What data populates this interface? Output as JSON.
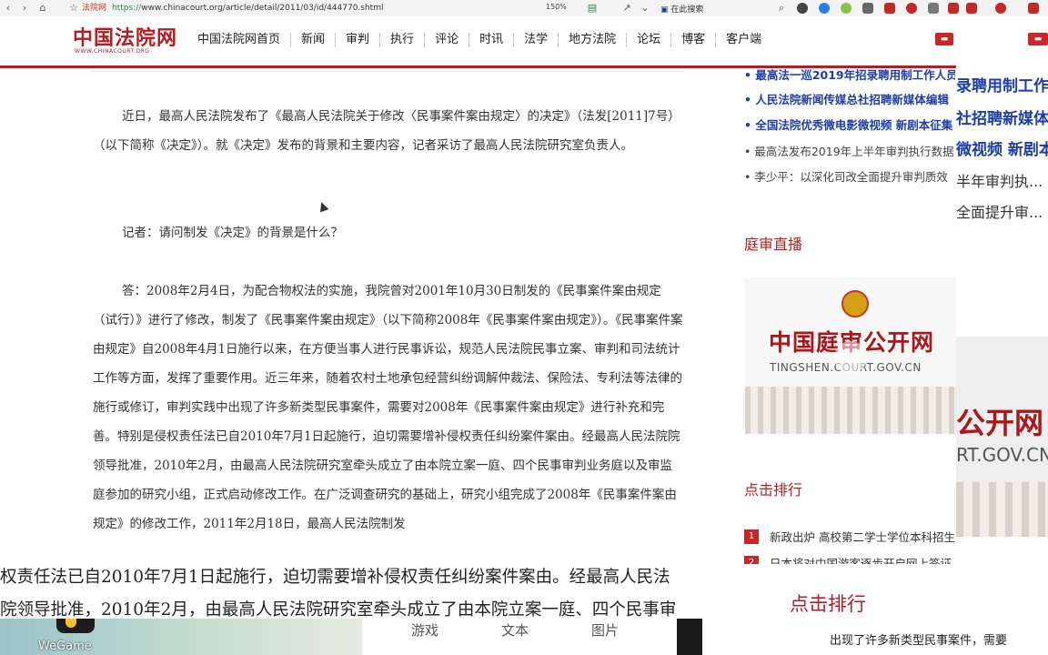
{
  "browser": {
    "site_label": "法院网",
    "url_scheme": "https://",
    "url_rest": "www.chinacourt.org/article/detail/2011/03/id/444770.shtml",
    "zoom": "150%",
    "search_placeholder": "在此搜索"
  },
  "site": {
    "logo_text": "中国法院网",
    "logo_sub": "WWW.CHINACOURT.ORG",
    "nav": [
      "中国法院网首页",
      "新闻",
      "审判",
      "执行",
      "评论",
      "时讯",
      "法学",
      "地方法院",
      "论坛",
      "博客",
      "客户端"
    ]
  },
  "article": {
    "para1": "近日，最高人民法院发布了《最高人民法院关于修改〈民事案件案由规定〉的决定》（法发[2011]7号）（以下简称《决定》）。就《决定》发布的背景和主要内容，记者采访了最高人民法院研究室负责人。",
    "para2": "记者：请问制发《决定》的背景是什么？",
    "para3": "答：2008年2月4日，为配合物权法的实施，我院曾对2001年10月30日制发的《民事案件案由规定（试行）》进行了修改，制发了《民事案件案由规定》（以下简称2008年《民事案件案由规定》）。《民事案件案由规定》自2008年4月1日施行以来，在方便当事人进行民事诉讼，规范人民法院民事立案、审判和司法统计工作等方面，发挥了重要作用。近三年来，随着农村土地承包经营纠纷调解仲裁法、保险法、专利法等法律的施行或修订，审判实践中出现了许多新类型民事案件，需要对2008年《民事案件案由规定》进行补充和完善。特别是侵权责任法已自2010年7月1日起施行，迫切需要增补侵权责任纠纷案件案由。经最高人民法院院领导批准，2010年2月，由最高人民法院研究室牵头成立了由本院立案一庭、四个民事审判业务庭以及审监庭参加的研究小组，正式启动修改工作。在广泛调查研究的基础上，研究小组完成了2008年《民事案件案由规定》的修改工作，2011年2月18日，最高人民法院制发"
  },
  "sidebar": {
    "news": [
      {
        "text": "最高法一巡2019年招录聘用制工作人员",
        "style": "blue"
      },
      {
        "text": "人民法院新闻传媒总社招聘新媒体编辑",
        "style": "blue"
      },
      {
        "text": "全国法院优秀微电影微视频 新剧本征集",
        "style": "blue"
      },
      {
        "text": "最高法发布2019年上半年审判执行数据",
        "style": "grey"
      },
      {
        "text": "李少平：以深化司改全面提升审判质效",
        "style": "grey"
      }
    ],
    "live_title": "庭审直播",
    "banner_title": "中国庭审公开网",
    "banner_domain": "TINGSHEN.COURT.GOV.CN",
    "rank_title": "点击排行",
    "ranking": [
      {
        "num": "1",
        "text": "新政出炉 高校第二学士学位本科招生"
      },
      {
        "num": "2",
        "text": "日本将对中国游客逐步开启网上签证"
      }
    ]
  },
  "overlay": {
    "right_ghost": [
      "录聘用制工作",
      "社招聘新媒体",
      "微视频 新剧本",
      "半年审判执...",
      "全面提升审..."
    ],
    "banner_ghost_title": "公开网",
    "banner_ghost_domain": "RT.GOV.CN",
    "line1": "权责任法已自2010年7月1日起施行，迫切需要增补侵权责任纠纷案件案由。经最高人民法",
    "line2": "院领导批准，2010年2月，由最高人民法院研究室牵头成立了由本院立案一庭、四个民事审",
    "rank_big": "点击排行",
    "bottom_right": "出现了许多新类型民事案件，需要"
  },
  "taskbar": {
    "wegame_label": "WeGame",
    "tabs": [
      "游戏",
      "文本",
      "图片"
    ]
  },
  "colors": {
    "brand_red": "#b81c22",
    "link_blue": "#1d3ea8"
  }
}
